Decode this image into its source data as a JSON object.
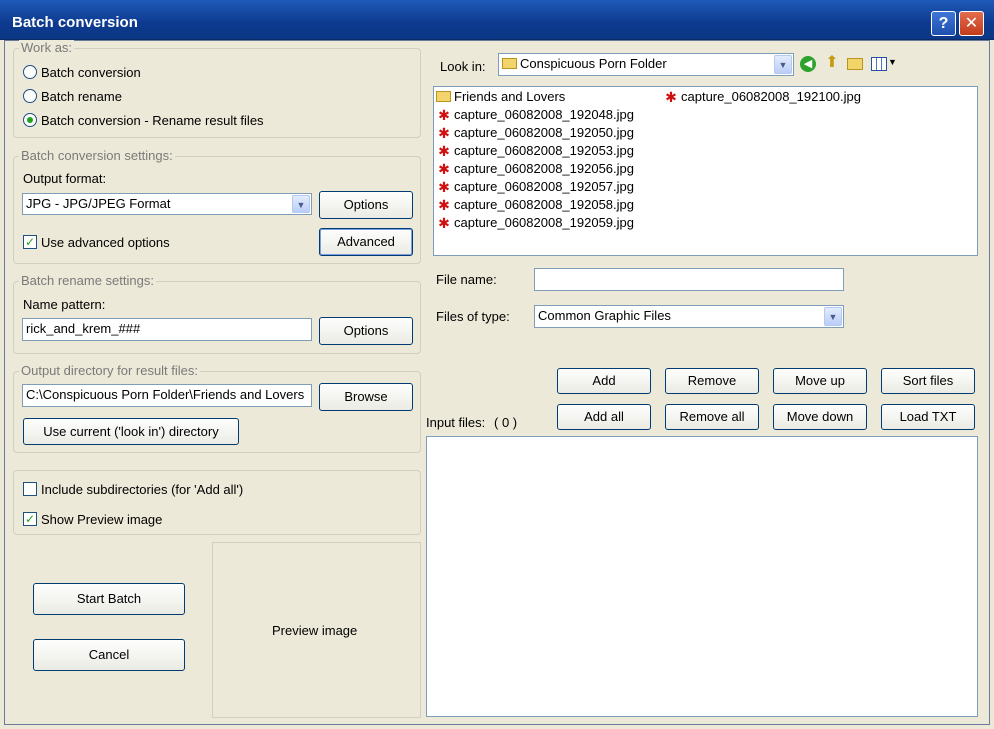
{
  "window": {
    "title": "Batch conversion",
    "help_label": "?",
    "close_label": "✕"
  },
  "work_as": {
    "legend": "Work as:",
    "options": [
      "Batch conversion",
      "Batch rename",
      "Batch conversion - Rename result files"
    ],
    "selected": 2
  },
  "conversion": {
    "legend": "Batch conversion settings:",
    "output_format_label": "Output format:",
    "output_format": "JPG - JPG/JPEG Format",
    "options_label": "Options",
    "advanced_label": "Advanced",
    "use_advanced_label": "Use advanced options",
    "use_advanced": true
  },
  "rename": {
    "legend": "Batch rename settings:",
    "name_pattern_label": "Name pattern:",
    "name_pattern": "rick_and_krem_###",
    "options_label": "Options"
  },
  "output_dir": {
    "legend": "Output directory for result files:",
    "path": "C:\\Conspicuous Porn Folder\\Friends and Lovers",
    "browse_label": "Browse",
    "use_current_label": "Use current ('look in') directory"
  },
  "misc": {
    "include_subdirs_label": "Include subdirectories (for 'Add all')",
    "include_subdirs": false,
    "show_preview_label": "Show Preview image",
    "show_preview": true
  },
  "actions": {
    "start_label": "Start Batch",
    "cancel_label": "Cancel"
  },
  "preview": {
    "label": "Preview image"
  },
  "browser": {
    "look_in_label": "Look in:",
    "look_in_value": "Conspicuous Porn Folder",
    "file_name_label": "File name:",
    "file_name_value": "",
    "files_of_type_label": "Files of type:",
    "files_of_type_value": "Common Graphic Files",
    "entries": [
      {
        "name": "Friends and Lovers",
        "type": "folder"
      },
      {
        "name": "capture_06082008_192048.jpg",
        "type": "file"
      },
      {
        "name": "capture_06082008_192050.jpg",
        "type": "file"
      },
      {
        "name": "capture_06082008_192053.jpg",
        "type": "file"
      },
      {
        "name": "capture_06082008_192056.jpg",
        "type": "file"
      },
      {
        "name": "capture_06082008_192057.jpg",
        "type": "file"
      },
      {
        "name": "capture_06082008_192058.jpg",
        "type": "file"
      },
      {
        "name": "capture_06082008_192059.jpg",
        "type": "file"
      },
      {
        "name": "capture_06082008_192100.jpg",
        "type": "file"
      }
    ]
  },
  "input_list": {
    "label": "Input files:",
    "count": "( 0 )"
  },
  "list_buttons": {
    "add": "Add",
    "remove": "Remove",
    "move_up": "Move up",
    "sort_files": "Sort files",
    "add_all": "Add all",
    "remove_all": "Remove all",
    "move_down": "Move down",
    "load_txt": "Load TXT"
  }
}
